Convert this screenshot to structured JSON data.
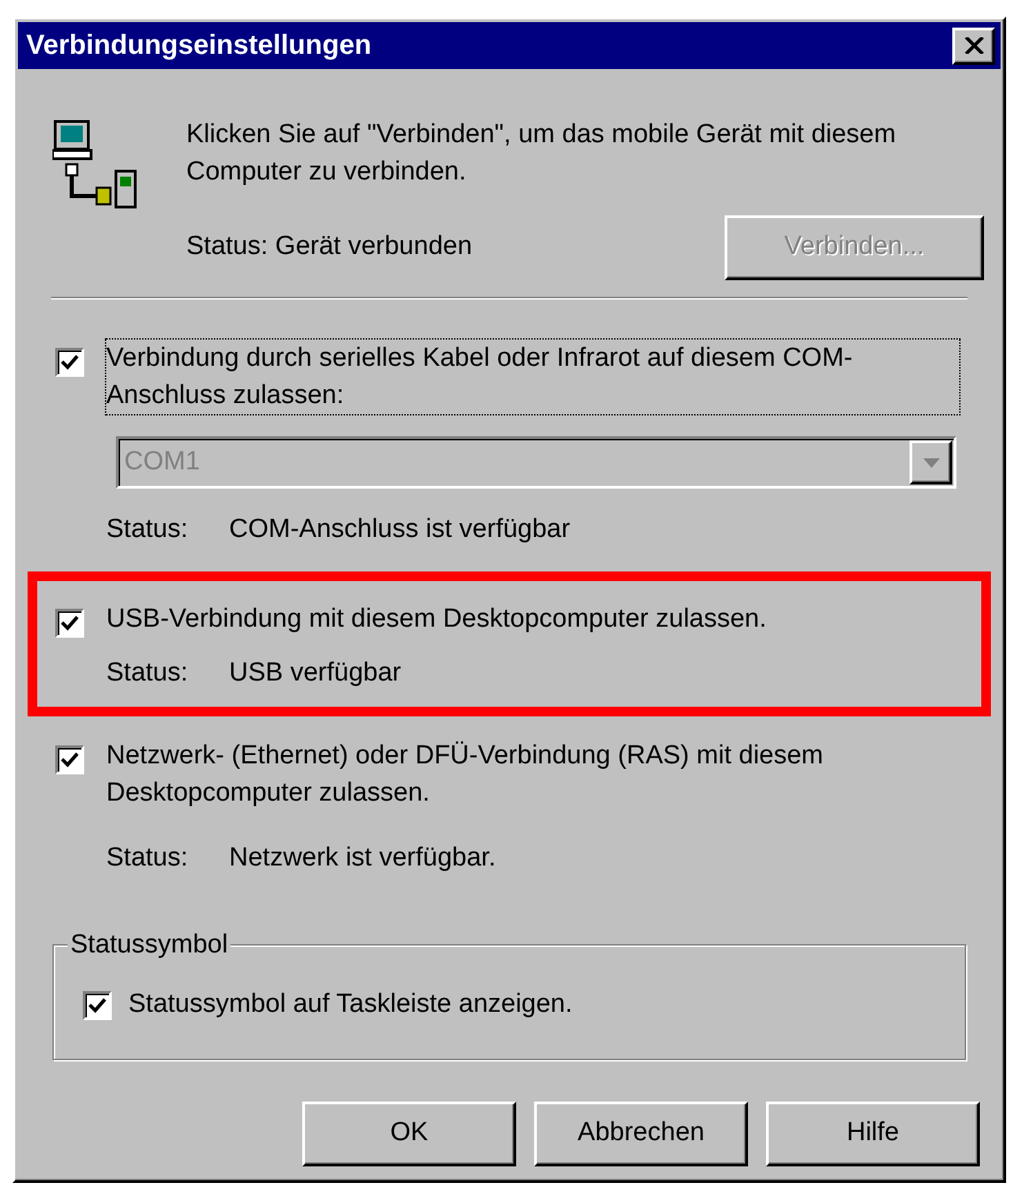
{
  "window": {
    "title": "Verbindungseinstellungen"
  },
  "intro": {
    "text": "Klicken Sie auf \"Verbinden\", um das mobile Gerät mit diesem Computer zu verbinden.",
    "status": "Status: Gerät verbunden",
    "connect_button": {
      "label": "Verbinden...",
      "disabled": true
    }
  },
  "connections": [
    {
      "label": "Verbindung durch serielles Kabel oder Infrarot auf diesem COM-Anschluss zulassen:",
      "checked": true,
      "focused": true,
      "highlighted": false,
      "dropdown": {
        "value": "COM1",
        "disabled": true
      },
      "status_label": "Status:",
      "status": "COM-Anschluss ist verfügbar"
    },
    {
      "label": "USB-Verbindung mit diesem Desktopcomputer zulassen.",
      "checked": true,
      "focused": false,
      "highlighted": true,
      "status_label": "Status:",
      "status": "USB verfügbar"
    },
    {
      "label": "Netzwerk- (Ethernet) oder DFÜ-Verbindung (RAS) mit diesem Desktopcomputer zulassen.",
      "checked": true,
      "focused": false,
      "highlighted": false,
      "status_label": "Status:",
      "status": "Netzwerk ist verfügbar."
    }
  ],
  "status_icon_group": {
    "title": "Statussymbol",
    "option": {
      "label": "Statussymbol auf Taskleiste anzeigen.",
      "checked": true
    }
  },
  "buttons": [
    {
      "label": "OK"
    },
    {
      "label": "Abbrechen"
    },
    {
      "label": "Hilfe"
    }
  ]
}
